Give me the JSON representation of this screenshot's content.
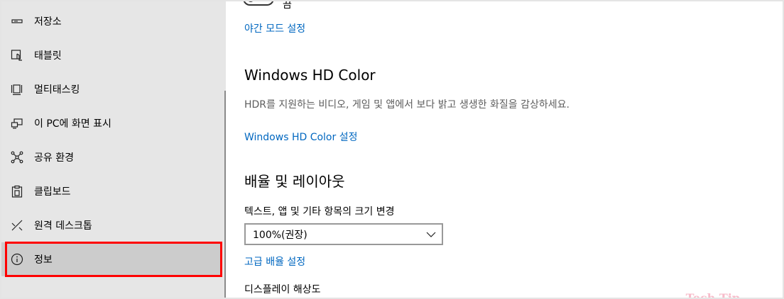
{
  "sidebar": {
    "items": [
      {
        "label": "저장소",
        "icon": "storage-icon"
      },
      {
        "label": "태블릿",
        "icon": "tablet-icon"
      },
      {
        "label": "멀티태스킹",
        "icon": "multitasking-icon"
      },
      {
        "label": "이 PC에 화면 표시",
        "icon": "project-to-pc-icon"
      },
      {
        "label": "공유 환경",
        "icon": "shared-experiences-icon"
      },
      {
        "label": "클립보드",
        "icon": "clipboard-icon"
      },
      {
        "label": "원격 데스크톱",
        "icon": "remote-desktop-icon"
      },
      {
        "label": "정보",
        "icon": "info-icon"
      }
    ],
    "selected_index": 7
  },
  "main": {
    "toggle_state": "끔",
    "night_light_link": "야간 모드 설정",
    "hd_color": {
      "heading": "Windows HD Color",
      "description": "HDR를 지원하는 비디오, 게임 및 앱에서 보다 밝고 생생한 화질을 감상하세요.",
      "link": "Windows HD Color 설정"
    },
    "scale_layout": {
      "heading": "배율 및 레이아웃",
      "text_size_label": "텍스트, 앱 및 기타 항목의 크기 변경",
      "dropdown_value": "100%(권장)",
      "advanced_link": "고급 배율 설정",
      "resolution_label": "디스플레이 해상도"
    }
  },
  "colors": {
    "sidebar_bg": "#e6e6e6",
    "selected_bg": "#cccccc",
    "highlight_border": "#ff0000",
    "link": "#0067c0"
  },
  "watermark": "Tech Tip"
}
